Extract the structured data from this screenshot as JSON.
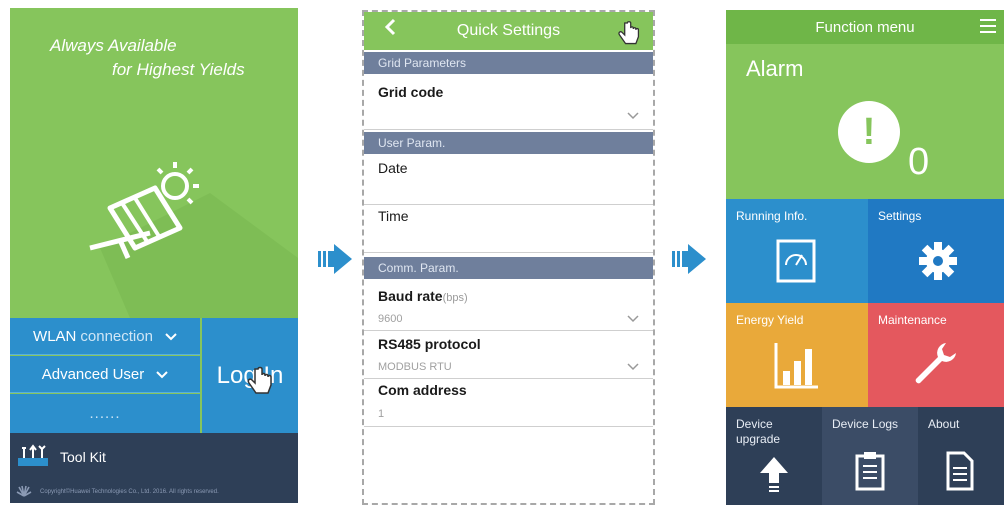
{
  "login": {
    "tagline_line1": "Always Available",
    "tagline_line2": "for Highest Yields",
    "wlan": {
      "label": "WLAN",
      "label_suffix": "connection"
    },
    "user": {
      "label": "Advanced User"
    },
    "password": {
      "value": "......"
    },
    "login_button": "Log In",
    "toolkit": "Tool Kit",
    "copyright": "Copyright©Huawei Technologies Co., Ltd. 2016. All rights reserved."
  },
  "quick_settings": {
    "title": "Quick Settings",
    "sections": {
      "grid": "Grid Parameters",
      "user": "User Param.",
      "comm": "Comm. Param."
    },
    "fields": {
      "grid_code": {
        "label": "Grid code",
        "value": ""
      },
      "date": {
        "label": "Date",
        "value": ""
      },
      "time": {
        "label": "Time",
        "value": ""
      },
      "baud_rate": {
        "label": "Baud rate",
        "unit": "(bps)",
        "value": "9600"
      },
      "rs485": {
        "label": "RS485 protocol",
        "value": "MODBUS RTU"
      },
      "com_address": {
        "label": "Com address",
        "value": "1"
      }
    }
  },
  "function_menu": {
    "title": "Function menu",
    "alarm": {
      "title": "Alarm",
      "count": "0"
    },
    "tiles": {
      "running": "Running Info.",
      "settings": "Settings",
      "energy": "Energy Yield",
      "maintenance": "Maintenance",
      "upgrade_line1": "Device",
      "upgrade_line2": "upgrade",
      "logs": "Device Logs",
      "about": "About"
    }
  },
  "colors": {
    "green": "#86c55c",
    "blue": "#2c8fcc",
    "navy": "#2e3f57",
    "orange": "#e9a93a",
    "red": "#e4585e",
    "section_gray": "#6f7f9c"
  }
}
